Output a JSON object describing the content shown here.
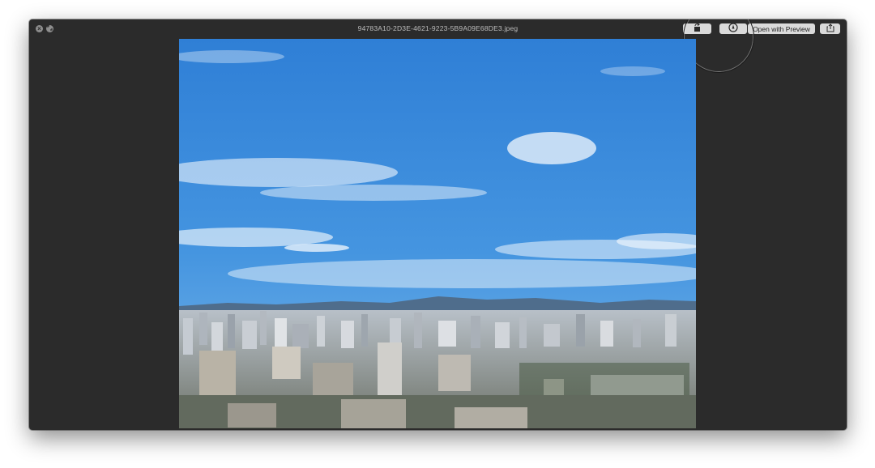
{
  "window": {
    "title": "94783A10-2D3E-4621-9223-5B9A09E68DE3.jpeg"
  },
  "toolbar": {
    "open_with_label": "Open with Preview",
    "rotate_icon": "rotate-left-icon",
    "markup_icon": "markup-pen-icon",
    "share_icon": "share-icon"
  },
  "traffic_lights": {
    "close_icon": "close-icon",
    "fullscreen_icon": "fullscreen-icon"
  },
  "image": {
    "content": "city-skyline-photo",
    "colors": {
      "sky_top": "#2f7fd6",
      "sky_bottom": "#6aaee6",
      "mountains": "#4f6d8c",
      "buildings": "#c9ccd0",
      "trees": "#3a4a38"
    }
  }
}
